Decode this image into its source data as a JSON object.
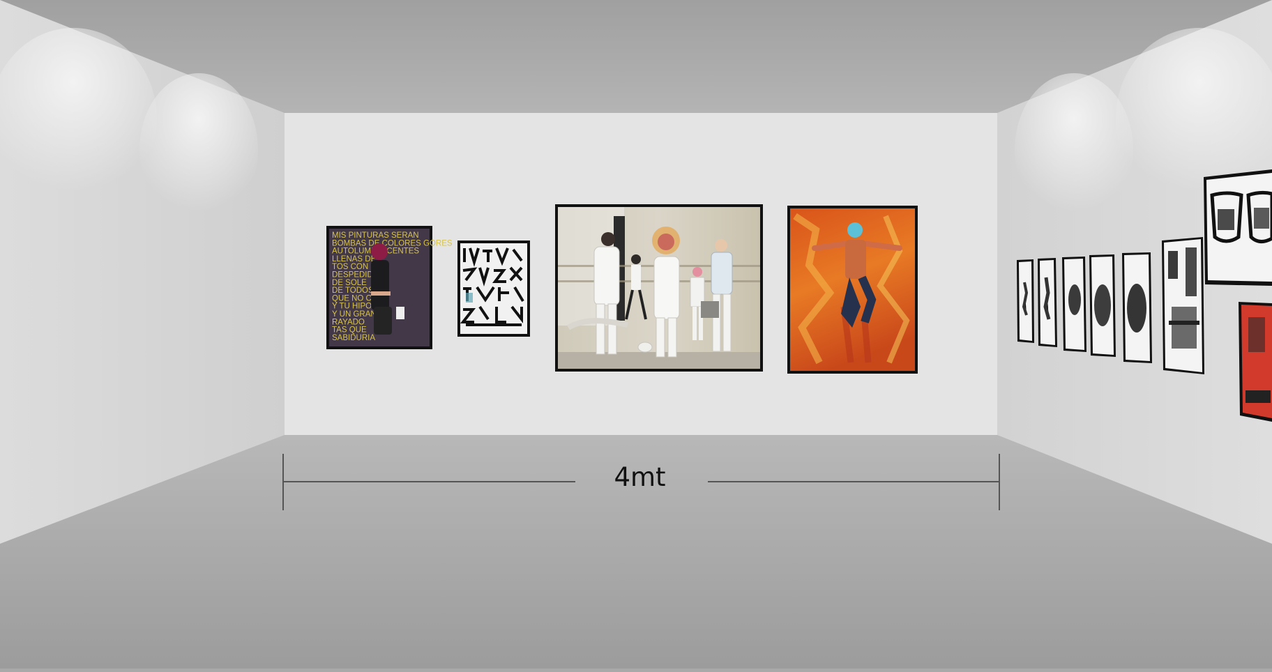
{
  "wall": {
    "width_label": "4mt"
  },
  "colors": {
    "ceiling": "#aaaaaa",
    "back_wall": "#e4e4e4",
    "side_wall": "#d7d7d7",
    "floor": "#a6a6a6",
    "frame": "#111111",
    "measure_line": "#555555"
  },
  "paintings": [
    {
      "name": "painting-text-portrait",
      "lines": [
        "MIS PINTURAS SERAN",
        "BOMBAS DE COLORES GORES",
        "AUTOLUMINISCENTES",
        "LLENAS DE",
        "TOS CON",
        "DESPEDIDA",
        "DE SOLE",
        "DE TODOS",
        "QUE NO COM",
        "Y TU HIPO",
        "Y UN GRAN",
        "RAYADO",
        "TAS QUE",
        "SABIDURIA"
      ]
    },
    {
      "name": "painting-calligraphy"
    },
    {
      "name": "painting-figures-street"
    },
    {
      "name": "painting-orange-figure"
    }
  ],
  "side_artworks": [
    {
      "name": "side-print-1"
    },
    {
      "name": "side-print-2"
    },
    {
      "name": "side-print-3"
    },
    {
      "name": "side-print-4"
    },
    {
      "name": "side-print-5"
    },
    {
      "name": "side-print-city"
    },
    {
      "name": "side-print-glasses"
    },
    {
      "name": "side-print-red"
    }
  ]
}
